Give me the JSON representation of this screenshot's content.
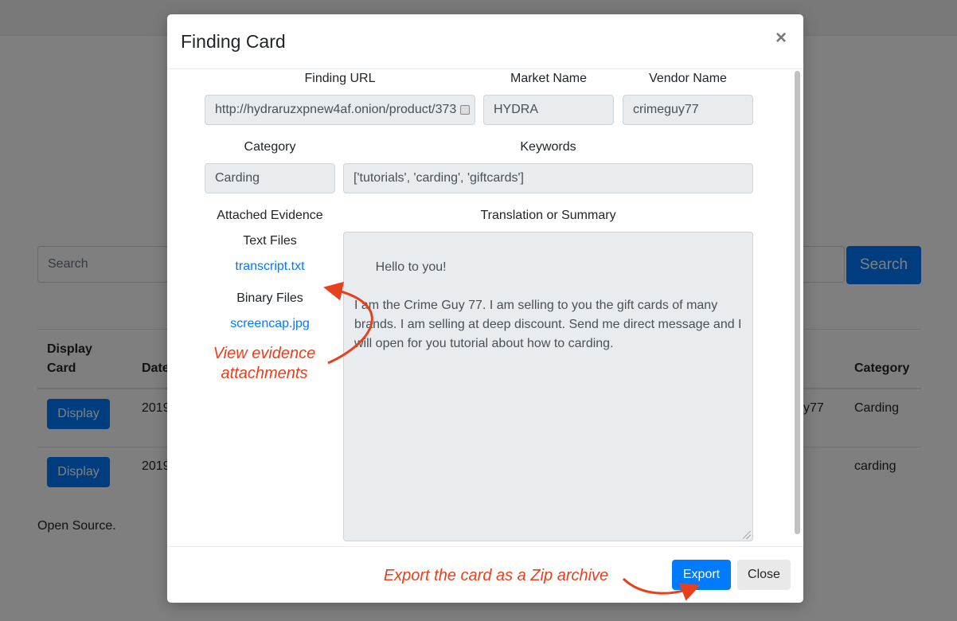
{
  "background": {
    "search_placeholder": "Search",
    "search_button": "Search",
    "table": {
      "headers": [
        "Display\nCard",
        "Date",
        "Category"
      ],
      "rows": [
        {
          "button": "Display",
          "date": "2019",
          "vendor": "y77",
          "category": "Carding"
        },
        {
          "button": "Display",
          "date": "2019",
          "vendor": "",
          "category": "carding"
        }
      ]
    },
    "footer": "Open Source."
  },
  "modal": {
    "title": "Finding Card",
    "close_symbol": "×",
    "labels": {
      "finding_url": "Finding URL",
      "market_name": "Market Name",
      "vendor_name": "Vendor Name",
      "category": "Category",
      "keywords": "Keywords",
      "attached_evidence": "Attached Evidence",
      "translation": "Translation or Summary",
      "text_files": "Text Files",
      "binary_files": "Binary Files"
    },
    "values": {
      "finding_url": "http://hydraruzxpnew4af.onion/product/373",
      "market_name": "HYDRA",
      "vendor_name": "crimeguy77",
      "category": "Carding",
      "keywords": "['tutorials', 'carding', 'giftcards']",
      "summary": "Hello to you!\n\nI am the Crime Guy 77. I am selling to you the gift cards of many brands. I am selling at deep discount. Send me direct message and I will open for you tutorial about how to carding."
    },
    "files": {
      "text": [
        "transcript.txt"
      ],
      "binary": [
        "screencap.jpg"
      ]
    },
    "buttons": {
      "export": "Export",
      "close": "Close"
    }
  },
  "annotations": {
    "evidence": "View evidence\nattachments",
    "export": "Export the card as a Zip archive",
    "color": "#e8401c"
  },
  "colors": {
    "primary": "#007bff",
    "readonly_field": "#e9ecef"
  }
}
